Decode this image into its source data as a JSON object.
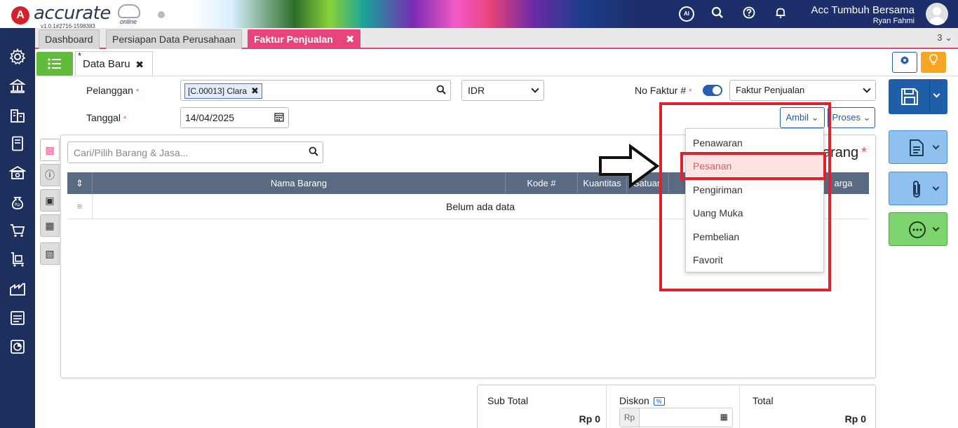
{
  "app": {
    "logo_mark": "A",
    "logo_text": "accurate",
    "logo_sub": "online",
    "version": "v1.0.1#2716-1598383",
    "ai_label": "AI",
    "company": "Acc Tumbuh Bersama",
    "user": "Ryan Fahmi"
  },
  "tabs": [
    {
      "label": "Dashboard"
    },
    {
      "label": "Persiapan Data Perusahaan"
    },
    {
      "label": "Faktur Penjualan",
      "close": "✖"
    }
  ],
  "tab_count": "3 ⌄",
  "subtab": {
    "star": "*",
    "label": "Data Baru",
    "close": "✖"
  },
  "form": {
    "pelanggan_label": "Pelanggan",
    "required_mark": "*",
    "customer_chip": "[C.00013] Clara",
    "chip_close": "✖",
    "currency": "IDR",
    "tanggal_label": "Tanggal",
    "tanggal_value": "14/04/2025",
    "no_faktur_label": "No Faktur #",
    "faktur_type": "Faktur Penjualan"
  },
  "actions": {
    "ambil": "Ambil",
    "proses": "Proses"
  },
  "items": {
    "search_placeholder": "Cari/Pilih Barang & Jasa...",
    "section_title": "Rincian Barang",
    "section_title_visible": "arang",
    "columns": [
      "Nama Barang",
      "Kode #",
      "Kuantitas",
      "Satuan",
      "Harga"
    ],
    "columns_visible": [
      "Nama Barang",
      "Kode #",
      "Kuantitas",
      "Satuan",
      "arga"
    ],
    "sort_icon": "⇕",
    "empty": "Belum ada data"
  },
  "totals": {
    "subtotal_label": "Sub Total",
    "subtotal_value": "Rp 0",
    "diskon_label": "Diskon",
    "diskon_pct": "%",
    "diskon_prefix": "Rp",
    "total_label": "Total",
    "total_value": "Rp 0"
  },
  "dropdown": {
    "items": [
      "Penawaran",
      "Pesanan",
      "Pengiriman",
      "Uang Muka",
      "Pembelian",
      "Favorit"
    ],
    "highlighted": "Pesanan"
  },
  "colors": {
    "accent": "#e8437a",
    "primary": "#1f5ea8",
    "sidebar": "#1d2f5c",
    "green": "#62bb3a",
    "annotation": "#e0202a"
  }
}
